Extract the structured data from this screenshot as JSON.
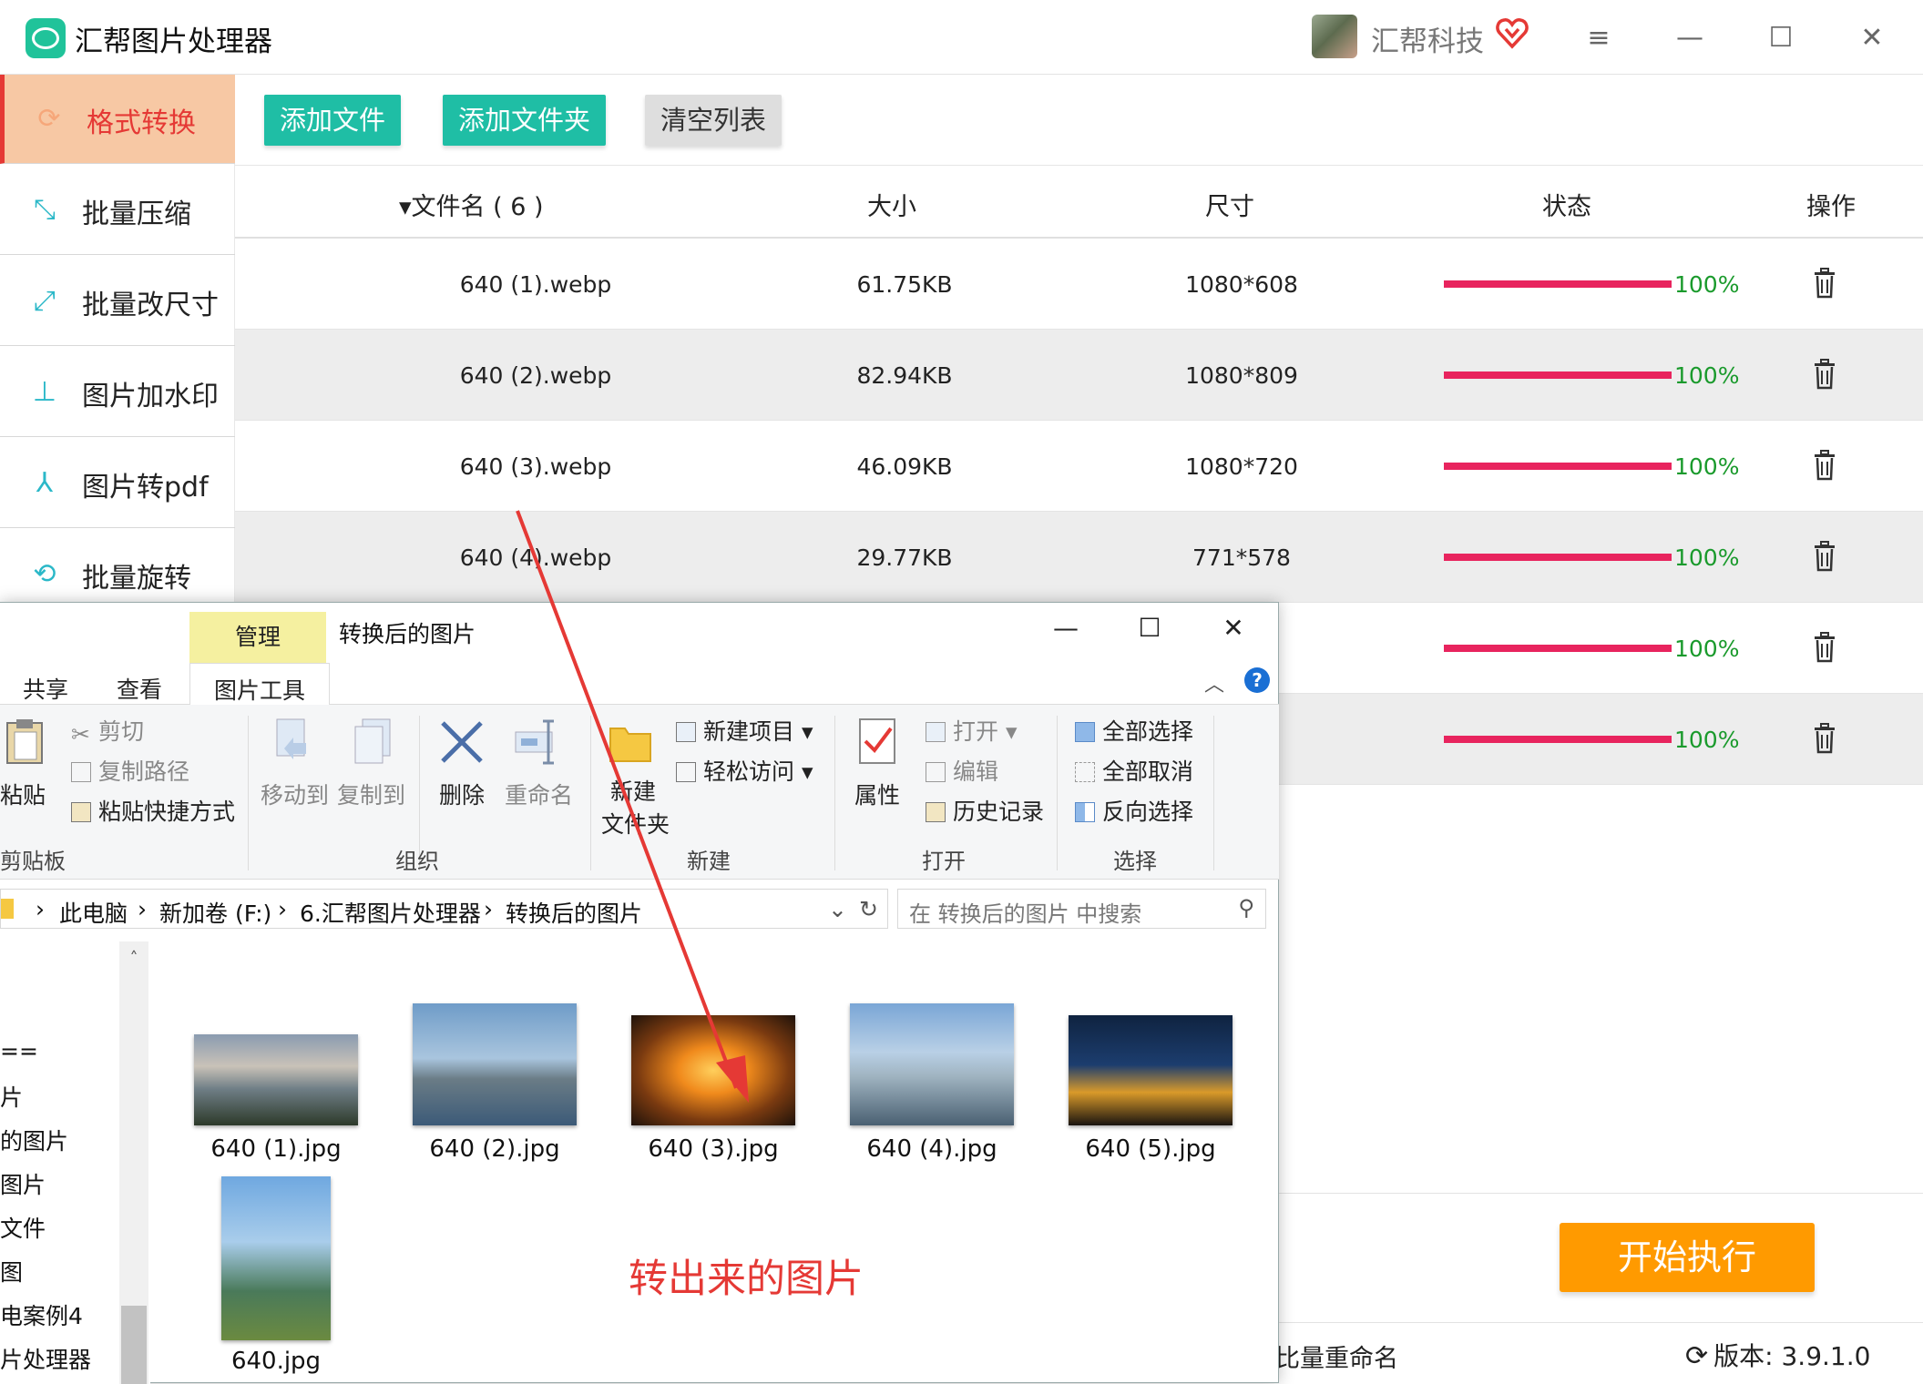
{
  "app": {
    "title": "汇帮图片处理器",
    "company": "汇帮科技"
  },
  "window_controls": {
    "menu": "≡",
    "minimize": "—",
    "maximize": "☐",
    "close": "✕"
  },
  "sidebar": {
    "items": [
      {
        "label": "格式转换",
        "active": true,
        "icon": "format-convert-icon"
      },
      {
        "label": "批量压缩",
        "icon": "compress-icon"
      },
      {
        "label": "批量改尺寸",
        "icon": "resize-icon"
      },
      {
        "label": "图片加水印",
        "icon": "watermark-icon"
      },
      {
        "label": "图片转pdf",
        "icon": "pdf-icon"
      },
      {
        "label": "批量旋转",
        "icon": "rotate-icon"
      }
    ]
  },
  "toolbar": {
    "add_file": "添加文件",
    "add_folder": "添加文件夹",
    "clear_list": "清空列表"
  },
  "table": {
    "headers": {
      "filename": "▾文件名 ( 6 )",
      "size": "大小",
      "dimensions": "尺寸",
      "status": "状态",
      "action": "操作"
    },
    "rows": [
      {
        "name": "640 (1).webp",
        "size": "61.75KB",
        "dim": "1080*608",
        "progress": 1.0,
        "pct": "100%"
      },
      {
        "name": "640 (2).webp",
        "size": "82.94KB",
        "dim": "1080*809",
        "progress": 1.0,
        "pct": "100%"
      },
      {
        "name": "640 (3).webp",
        "size": "46.09KB",
        "dim": "1080*720",
        "progress": 1.0,
        "pct": "100%"
      },
      {
        "name": "640 (4).webp",
        "size": "29.77KB",
        "dim": "771*578",
        "progress": 1.0,
        "pct": "100%"
      },
      {
        "name": "",
        "size": "",
        "dim": "",
        "progress": 1.0,
        "pct": "100%"
      },
      {
        "name": "",
        "size": "",
        "dim": "",
        "progress": 1.0,
        "pct": "100%"
      }
    ],
    "progress_color": "#e8245e",
    "pct_color": "#1a9a2c"
  },
  "actions": {
    "start": "开始执行"
  },
  "status_bar": {
    "rename": "比量重命名",
    "version_label": "版本: ",
    "version": "3.9.1.0"
  },
  "explorer": {
    "manage_tab": "管理",
    "title": "转换后的图片",
    "tabs": {
      "share": "共享",
      "view": "查看",
      "picture_tools": "图片工具"
    },
    "ribbon": {
      "paste": "粘贴",
      "cut": "剪切",
      "copy_path": "复制路径",
      "paste_shortcut": "粘贴快捷方式",
      "clipboard_group": "剪贴板",
      "move_to": "移动到",
      "copy_to": "复制到",
      "delete": "删除",
      "rename": "重命名",
      "organize_group": "组织",
      "new_folder_1": "新建",
      "new_folder_2": "文件夹",
      "new_item": "新建项目 ▾",
      "easy_access": "轻松访问 ▾",
      "new_group": "新建",
      "properties": "属性",
      "open": "打开 ▾",
      "edit": "编辑",
      "history": "历史记录",
      "open_group": "打开",
      "select_all": "全部选择",
      "select_none": "全部取消",
      "invert_selection": "反向选择",
      "select_group": "选择"
    },
    "breadcrumb": [
      "此电脑",
      "新加卷 (F:)",
      "6.汇帮图片处理器",
      "转换后的图片"
    ],
    "search_placeholder": "在 转换后的图片 中搜索",
    "nav_items": [
      "==",
      "片",
      "的图片",
      "图片",
      "文件",
      "图",
      "电案例4",
      "片处理器"
    ],
    "files": [
      "640 (1).jpg",
      "640 (2).jpg",
      "640 (3).jpg",
      "640 (4).jpg",
      "640 (5).jpg",
      "640.jpg"
    ],
    "annotation": "转出来的图片"
  }
}
